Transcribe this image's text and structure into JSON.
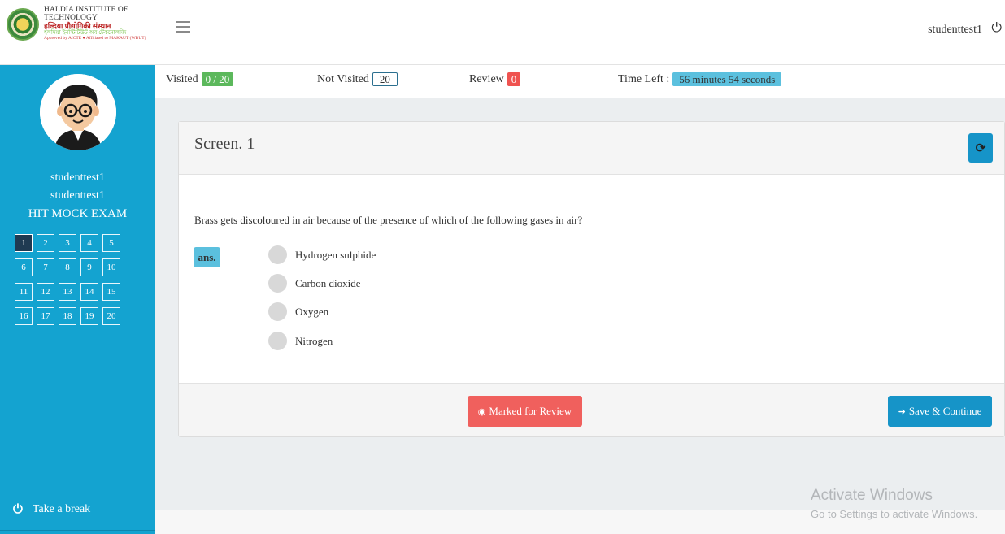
{
  "header": {
    "logo_line1": "HALDIA INSTITUTE OF TECHNOLOGY",
    "logo_line2": "हल्दिया प्रौद्योगिकी संस्थान",
    "logo_line3": "হলদিয়া ইনস্টিটিউট অব টেকনোলজি",
    "logo_line4": "Approved by AICTE ● Affiliated to MAKAUT (WBUT)",
    "username": "studenttest1"
  },
  "sidebar": {
    "name1": "studenttest1",
    "name2": "studenttest1",
    "exam": "HIT MOCK EXAM",
    "questions": [
      "1",
      "2",
      "3",
      "4",
      "5",
      "6",
      "7",
      "8",
      "9",
      "10",
      "11",
      "12",
      "13",
      "14",
      "15",
      "16",
      "17",
      "18",
      "19",
      "20"
    ],
    "active_question": "1",
    "take_break": "Take a break"
  },
  "status": {
    "visited_label": "Visited",
    "visited_value": "0 / 20",
    "not_visited_label": "Not Visited",
    "not_visited_value": "20",
    "review_label": "Review",
    "review_value": "0",
    "time_left_label": "Time Left :",
    "time_left_value": "56 minutes 54 seconds"
  },
  "panel": {
    "title": "Screen. 1",
    "question": "Brass gets discoloured in air because of the presence of which of the following gases in air?",
    "ans_label": "ans.",
    "options": [
      "Hydrogen sulphide",
      "Carbon dioxide",
      "Oxygen",
      "Nitrogen"
    ],
    "review_button": "Marked for Review",
    "save_button": "Save & Continue"
  },
  "watermark": {
    "line1": "Activate Windows",
    "line2": "Go to Settings to activate Windows."
  },
  "colors": {
    "sidebar": "#14a3d0",
    "primary": "#1694c8",
    "danger": "#f0605d",
    "success": "#5cb85c",
    "info": "#5bc0de"
  }
}
